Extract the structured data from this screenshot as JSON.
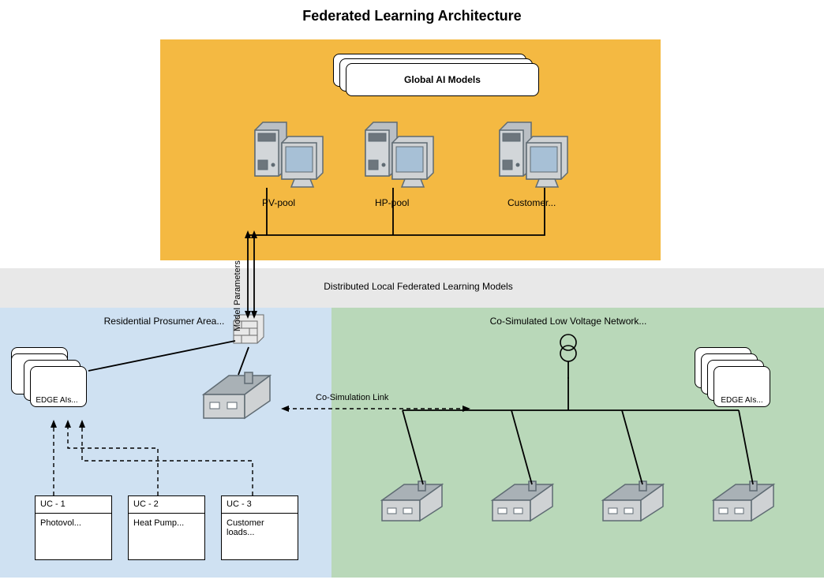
{
  "title": "Federated Learning Architecture",
  "global_models_label": "Global AI Models",
  "servers": {
    "pv": {
      "label": "PV-pool"
    },
    "hp": {
      "label": "HP-pool"
    },
    "customer": {
      "label": "Customer..."
    }
  },
  "mid_label": "Distributed Local Federated Learning Models",
  "residential_label": "Residential Prosumer Area...",
  "network_label": "Co-Simulated Low Voltage Network...",
  "edge_label_left": "EDGE AIs...",
  "edge_label_right": "EDGE AIs...",
  "edges_vertical_label": "Model Parameters",
  "co_sim_link_label": "Co-Simulation Link",
  "uc": [
    {
      "head": "UC - 1",
      "body": "Photovol..."
    },
    {
      "head": "UC - 2",
      "body": "Heat Pump..."
    },
    {
      "head": "UC - 3",
      "body": "Customer loads..."
    }
  ]
}
